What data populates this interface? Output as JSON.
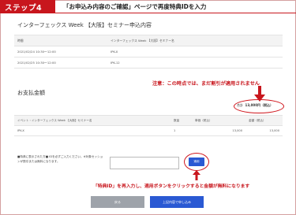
{
  "step": {
    "label": "ステップ4",
    "title": "「お申込み内容のご確認」ページで再度特典IDを入力"
  },
  "section1": {
    "title": "インターフェックス Week 【大阪】セミナー申込内容",
    "headers": [
      "時間",
      "インターフェックス Week 【大阪】セミナー名"
    ],
    "rows": [
      [
        "2021/02/24 10:30〜12:00",
        "IPK-X"
      ],
      [
        "2021/02/25 10:30〜12:00",
        "IPK-12"
      ]
    ]
  },
  "annotation_top": "注意：この時点では、まだ割引が適用されません",
  "section2": {
    "title": "お支払金額",
    "total_label": "合計",
    "total_value": "13,000円（税込）",
    "headers": [
      "イベント・インターフェックス Week 【大阪】セミナー名",
      "数量",
      "単価（税込）",
      "金額（税込）"
    ],
    "rows": [
      [
        "IPK-X",
        "1",
        "13,000",
        "13,000"
      ]
    ]
  },
  "token": {
    "label": "■特典に表示された方■ IDを必ずご入力ください。※対象セッションが割引または無料になります。",
    "input_value": "",
    "apply_label": "適用"
  },
  "annotation_bottom": "「特典ID」を再入力し、適用ボタンをクリックすると金額が無料になります",
  "buttons": {
    "back": "戻る",
    "submit": "上記内容で申し込み"
  },
  "colors": {
    "accent": "#c8161d",
    "button_blue": "#2a59d3",
    "button_gray": "#9ea3aa"
  }
}
